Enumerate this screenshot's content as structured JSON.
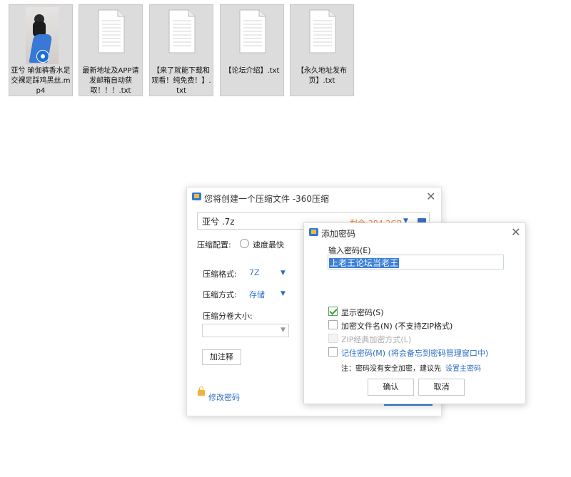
{
  "files": [
    {
      "name": "亚兮 瑜伽裤香水足交裸足踩鸡黑丝.mp4",
      "type": "video"
    },
    {
      "name": "最新地址及APP请发邮箱自动获取！！！.txt",
      "type": "text"
    },
    {
      "name": "【来了就能下载和观看！纯免费！】.txt",
      "type": "text"
    },
    {
      "name": "【论坛介绍】.txt",
      "type": "text"
    },
    {
      "name": "【永久地址发布页】.txt",
      "type": "text"
    }
  ],
  "main_dialog": {
    "title": "您将创建一个压缩文件 -360压缩",
    "archive_name": "亚兮 .7z",
    "remaining_space": "剩余:384.2GB",
    "config_label": "压缩配置:",
    "speed_option": "速度最快",
    "format_label": "压缩格式:",
    "format_value": "7Z",
    "method_label": "压缩方式:",
    "method_value": "存储",
    "split_label": "压缩分卷大小:",
    "comment_button": "加注释",
    "change_password_link": "修改密码"
  },
  "password_dialog": {
    "title": "添加密码",
    "input_label": "输入密码(E)",
    "password_value": "上老王论坛当老王",
    "options": [
      {
        "label": "显示密码(S)",
        "checked": true,
        "enabled": true
      },
      {
        "label": "加密文件名(N) (不支持ZIP格式)",
        "checked": false,
        "enabled": true
      },
      {
        "label": "ZIP经典加密方式(L)",
        "checked": false,
        "enabled": false
      },
      {
        "label": "记住密码(M) (将会备忘到密码管理窗口中)",
        "checked": false,
        "enabled": true
      }
    ],
    "note_text": "注：密码没有安全加密，建议先",
    "note_link": "设置主密码",
    "ok_button": "确认",
    "cancel_button": "取消"
  },
  "colors": {
    "accent_blue": "#2f6fc6",
    "warning_orange": "#f07a2a",
    "selection_blue": "#3b7fd6",
    "check_green": "#3a9a3a"
  }
}
